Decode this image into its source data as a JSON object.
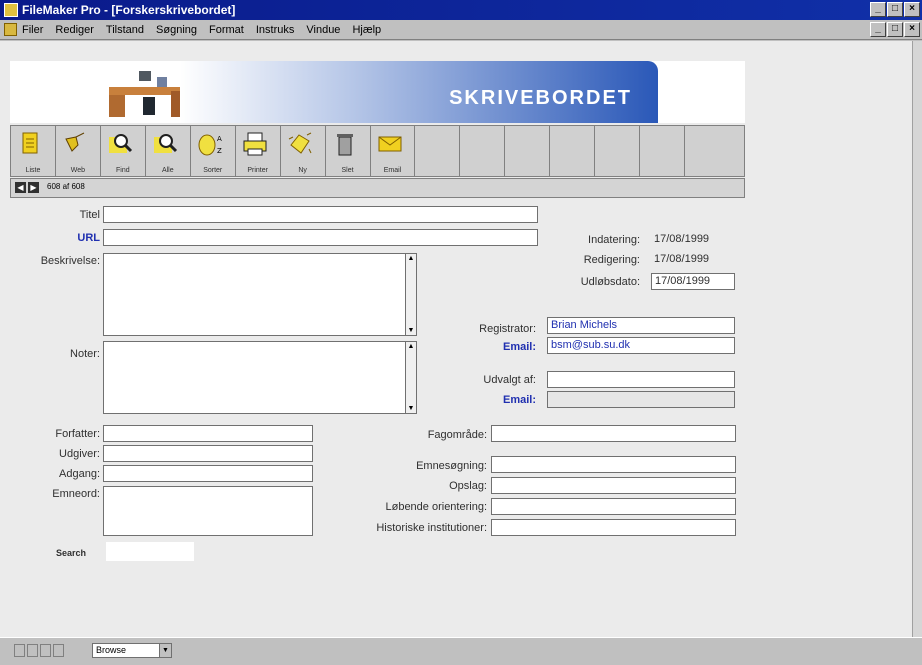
{
  "window": {
    "title": "FileMaker Pro - [Forskerskrivebordet]"
  },
  "menubar": {
    "items": [
      "Filer",
      "Rediger",
      "Tilstand",
      "Søgning",
      "Format",
      "Instruks",
      "Vindue",
      "Hjælp"
    ]
  },
  "header": {
    "banner_title": "SKRIVEBORDET"
  },
  "toolbar": {
    "buttons": [
      {
        "label": "Liste",
        "icon": "list-icon"
      },
      {
        "label": "Web",
        "icon": "web-icon"
      },
      {
        "label": "Find",
        "icon": "find-icon"
      },
      {
        "label": "Alle",
        "icon": "find-all-icon"
      },
      {
        "label": "Sorter",
        "icon": "sort-icon"
      },
      {
        "label": "Printer",
        "icon": "printer-icon"
      },
      {
        "label": "Ny",
        "icon": "new-record-icon"
      },
      {
        "label": "Slet",
        "icon": "trash-icon"
      },
      {
        "label": "Email",
        "icon": "email-icon"
      }
    ]
  },
  "recordbar": {
    "count": "608 af 608"
  },
  "form": {
    "titel": {
      "label": "Titel",
      "value": ""
    },
    "url": {
      "label": "URL",
      "value": ""
    },
    "beskrivelse": {
      "label": "Beskrivelse:",
      "value": ""
    },
    "noter": {
      "label": "Noter:",
      "value": ""
    },
    "indatering": {
      "label": "Indatering:",
      "value": "17/08/1999"
    },
    "redigering": {
      "label": "Redigering:",
      "value": "17/08/1999"
    },
    "udlobsdato": {
      "label": "Udløbsdato:",
      "value": "17/08/1999"
    },
    "registrator": {
      "label": "Registrator:",
      "value": "Brian Michels"
    },
    "registrator_email": {
      "label": "Email:",
      "value": "bsm@sub.su.dk"
    },
    "udvalgt_af": {
      "label": "Udvalgt af:",
      "value": ""
    },
    "udvalgt_email": {
      "label": "Email:",
      "value": ""
    },
    "forfatter": {
      "label": "Forfatter:",
      "value": ""
    },
    "udgiver": {
      "label": "Udgiver:",
      "value": ""
    },
    "adgang": {
      "label": "Adgang:",
      "value": ""
    },
    "emneord": {
      "label": "Emneord:",
      "value": ""
    },
    "search": {
      "label": "Search",
      "value": ""
    },
    "fagomrade": {
      "label": "Fagområde:",
      "value": ""
    },
    "emnesogning": {
      "label": "Emnesøgning:",
      "value": ""
    },
    "opslag": {
      "label": "Opslag:",
      "value": ""
    },
    "lobende": {
      "label": "Løbende orientering:",
      "value": ""
    },
    "historiske": {
      "label": "Historiske institutioner:",
      "value": ""
    }
  },
  "statusbar": {
    "mode": "Browse"
  },
  "colors": {
    "titlebar": "#0a1a8a",
    "banner": "#2a58b8",
    "link_label": "#2030b0"
  }
}
